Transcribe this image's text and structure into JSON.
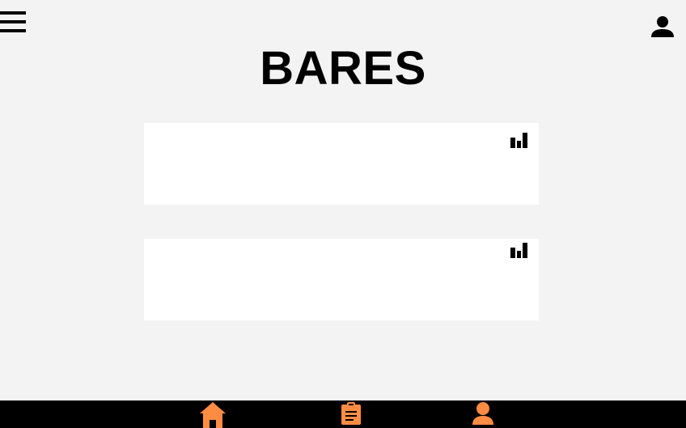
{
  "header": {
    "menu_icon": "hamburger-menu-icon",
    "profile_icon": "person-icon"
  },
  "page": {
    "title": "BARES"
  },
  "bars": [
    {
      "stats_icon": "bar-chart-icon"
    },
    {
      "stats_icon": "bar-chart-icon"
    }
  ],
  "bottom_nav": {
    "items": [
      {
        "icon": "home-icon",
        "color": "#ff8c42"
      },
      {
        "icon": "clipboard-list-icon",
        "color": "#ff8c42"
      },
      {
        "icon": "person-icon",
        "color": "#ff8c42"
      }
    ],
    "background": "#000000"
  },
  "colors": {
    "accent": "#ff8c42",
    "page_background": "#f3f3f3",
    "card_background": "#ffffff"
  }
}
